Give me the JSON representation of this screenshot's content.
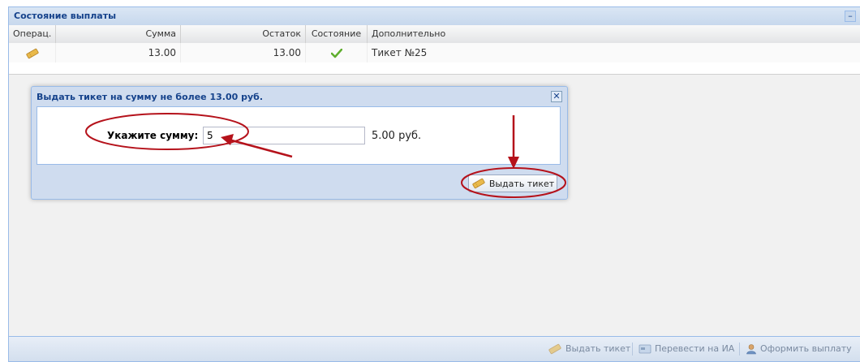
{
  "panel": {
    "title": "Состояние выплаты",
    "collapse_symbol": "–"
  },
  "grid": {
    "columns": [
      "Операц.",
      "Сумма",
      "Остаток",
      "Состояние",
      "Дополнительно"
    ],
    "rows": [
      {
        "operation_icon": "ticket-icon",
        "sum": "13.00",
        "remainder": "13.00",
        "state_icon": "checkmark-icon",
        "extra": "Тикет №25"
      }
    ]
  },
  "dialog": {
    "title": "Выдать тикет на сумму не более 13.00 руб.",
    "close_symbol": "✕",
    "amount_label": "Укажите сумму:",
    "amount_value": "5",
    "amount_formatted": "5.00 руб.",
    "issue_button_label": "Выдать тикет"
  },
  "toolbar": {
    "issue_ticket_label": "Выдать тикет",
    "transfer_label": "Перевести на ИА",
    "payout_label": "Оформить выплату"
  },
  "colors": {
    "accent": "#15428b",
    "annotation": "#b5121b",
    "check": "#5fae2e",
    "ticket": "#e9b94a"
  }
}
